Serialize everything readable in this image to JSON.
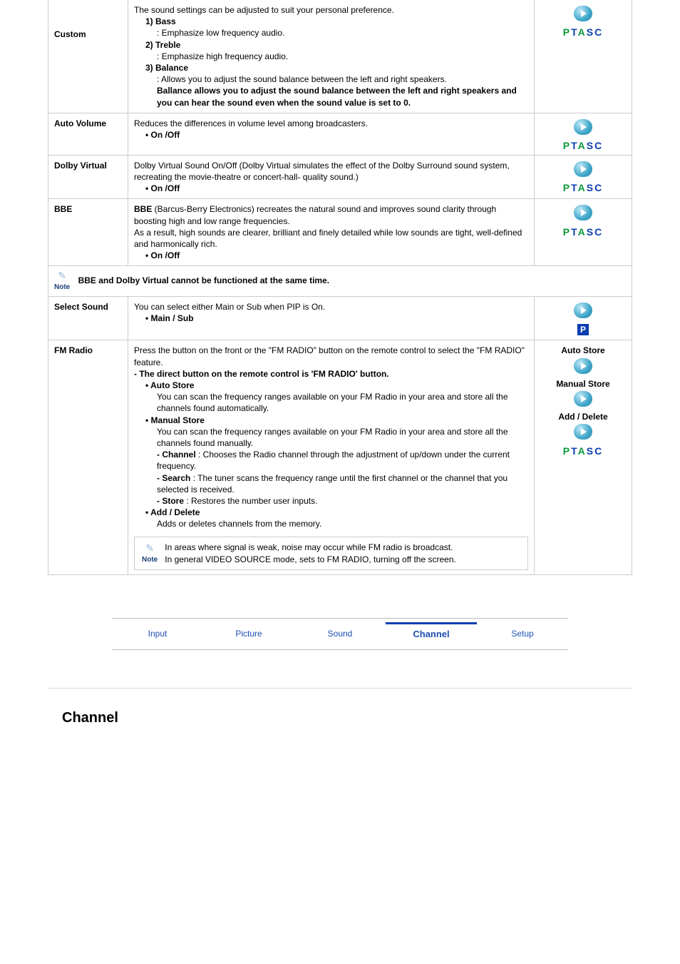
{
  "custom": {
    "label": "Custom",
    "intro": "The sound settings can be adjusted to suit your personal preference.",
    "items": [
      {
        "title": "1) Bass",
        "desc": ": Emphasize low frequency audio."
      },
      {
        "title": "2) Treble",
        "desc": ": Emphasize high frequency audio."
      },
      {
        "title": "3) Balance",
        "desc": ": Allows you to adjust the sound balance between the left and right speakers."
      }
    ],
    "extra": "Ballance allows you to adjust the sound balance between the left and right speakers and you can hear the sound even when the sound value is set to 0."
  },
  "autoVolume": {
    "label": "Auto Volume",
    "desc": "Reduces the differences in volume level among broadcasters.",
    "opt": "• On /Off"
  },
  "dolby": {
    "label": "Dolby Virtual",
    "desc": "Dolby Virtual Sound On/Off (Dolby Virtual simulates the effect of the Dolby Surround sound system, recreating the movie-theatre or concert-hall- quality sound.)",
    "opt": "• On /Off"
  },
  "bbe": {
    "label": "BBE",
    "title": "BBE",
    "desc1": " (Barcus-Berry Electronics) recreates the natural sound and improves sound clarity through boosting high and low range frequencies.",
    "desc2": "As a result, high sounds are clearer, brilliant and finely detailed while low sounds are tight, well-defined and harmonically rich.",
    "opt": "• On /Off"
  },
  "note": {
    "label": "Note",
    "text": "BBE and Dolby Virtual cannot be functioned at the same time."
  },
  "selectSound": {
    "label": "Select Sound",
    "desc": "You can select either Main or Sub when PIP is On.",
    "opt": "• Main / Sub"
  },
  "fm": {
    "label": "FM Radio",
    "intro1": "Press the button on the front or the \"FM RADIO\" button on the remote control to select the \"FM RADIO\" feature.",
    "intro2": "- The direct button on the remote control is 'FM RADIO' button.",
    "auto_t": "• Auto Store",
    "auto_d": "You can scan the frequency ranges available on your FM Radio in your area and store all the channels found automatically.",
    "man_t": "• Manual Store",
    "man_d": "You can scan the frequency ranges available on your FM Radio in your area and store all the channels found manually.",
    "ch_t": "- Channel",
    "ch_d": " : Chooses the Radio channel through the adjustment of up/down under the current frequency.",
    "se_t": "- Search",
    "se_d": " : The tuner scans the frequency range until the first channel or the channel that you selected is received.",
    "st_t": "- Store",
    "st_d": " : Restores the number user inputs.",
    "add_t": "• Add / Delete",
    "add_d": "Adds or deletes channels from the memory.",
    "note1": "In areas where signal is weak, noise may occur while FM radio is broadcast.",
    "note2": "In general VIDEO SOURCE mode, sets to FM RADIO, turning off the screen.",
    "side": {
      "auto": "Auto Store",
      "manual": "Manual Store",
      "add": "Add / Delete"
    }
  },
  "ptasc": {
    "p": "P",
    "t": "T",
    "a": "A",
    "s": "S",
    "c": "C"
  },
  "tabs": [
    "Input",
    "Picture",
    "Sound",
    "Channel",
    "Setup"
  ],
  "heading": "Channel"
}
